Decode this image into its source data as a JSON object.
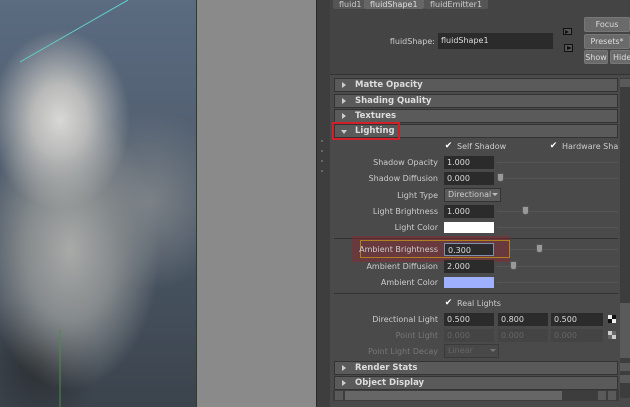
{
  "tabs": [
    {
      "label": "fluid1"
    },
    {
      "label": "fluidShape1"
    },
    {
      "label": "fluidEmitter1"
    }
  ],
  "node": {
    "label": "fluidShape:",
    "value": "fluidShape1"
  },
  "buttons": {
    "focus": "Focus",
    "presets": "Presets*",
    "show": "Show",
    "hide": "Hide"
  },
  "sections": {
    "matte": "Matte Opacity",
    "shading": "Shading Quality",
    "textures": "Textures",
    "lighting": "Lighting",
    "render": "Render Stats",
    "display": "Object Display"
  },
  "lighting": {
    "self_shadow": {
      "label": "Self Shadow",
      "checked": true
    },
    "hardware_shadow": {
      "label": "Hardware Shadow",
      "checked": true
    },
    "shadow_opacity": {
      "label": "Shadow Opacity",
      "value": "1.000"
    },
    "shadow_diffusion": {
      "label": "Shadow Diffusion",
      "value": "0.000"
    },
    "light_type": {
      "label": "Light Type",
      "value": "Directional"
    },
    "light_brightness": {
      "label": "Light Brightness",
      "value": "1.000"
    },
    "light_color": {
      "label": "Light Color",
      "color": "#ffffff"
    },
    "ambient_brightness": {
      "label": "Ambient Brightness",
      "value": "0.300"
    },
    "ambient_diffusion": {
      "label": "Ambient Diffusion",
      "value": "2.000"
    },
    "ambient_color": {
      "label": "Ambient Color",
      "color": "#9fb0ff"
    },
    "real_lights": {
      "label": "Real Lights",
      "checked": true
    },
    "directional_light": {
      "label": "Directional Light",
      "values": [
        "0.500",
        "0.800",
        "0.500"
      ]
    },
    "point_light": {
      "label": "Point Light",
      "values": [
        "0.000",
        "0.000",
        "0.000"
      ]
    },
    "point_light_decay": {
      "label": "Point Light Decay",
      "value": "Linear"
    }
  },
  "colors": {
    "highlight_red": "#d0202a",
    "ambient_highlight": "#b08020"
  }
}
